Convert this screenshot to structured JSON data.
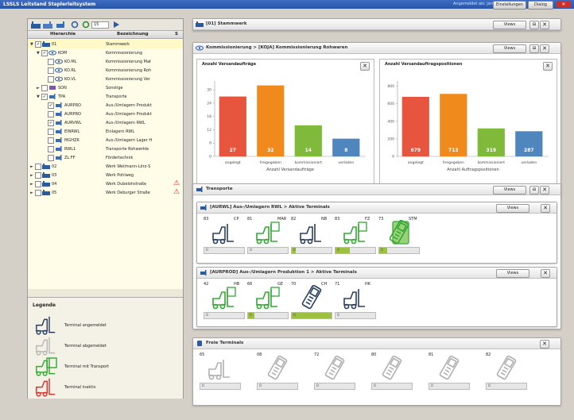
{
  "window": {
    "title": "LSSLS Leitstand Staplerleitsystem",
    "user": "Angemeldet als: jsrsdore",
    "settings_label": "Einstellungen",
    "logout_label": "Dialog",
    "close_glyph": "✕"
  },
  "tree": {
    "toolbar_value": "15",
    "headers": {
      "hierarchy": "Hierarchie",
      "name": "Bezeichnung",
      "sort": "S"
    },
    "rows": [
      {
        "label": "01",
        "desc": "Stammwerk",
        "indent": 0,
        "expander": "▼",
        "icon": "factory",
        "checked": true
      },
      {
        "label": "KOM",
        "desc": "Kommissionierung",
        "indent": 1,
        "expander": "▼",
        "icon": "eye",
        "checked": true
      },
      {
        "label": "KO.ML",
        "desc": "Kommissionierung Mat",
        "indent": 2,
        "expander": "",
        "icon": "eye",
        "checked": false
      },
      {
        "label": "KO.RL",
        "desc": "Kommissionierung Roh",
        "indent": 2,
        "expander": "",
        "icon": "eye",
        "checked": false
      },
      {
        "label": "KO.VL",
        "desc": "Kommissionierung Ver",
        "indent": 2,
        "expander": "",
        "icon": "eye",
        "checked": false
      },
      {
        "label": "SON",
        "desc": "Sonstige",
        "indent": 1,
        "expander": "►",
        "icon": "tag",
        "checked": false
      },
      {
        "label": "TPA",
        "desc": "Transporte",
        "indent": 1,
        "expander": "▼",
        "icon": "forklift",
        "checked": true
      },
      {
        "label": "AURPRO",
        "desc": "Aus-/Umlagern Produkt",
        "indent": 2,
        "expander": "",
        "icon": "forklift",
        "checked": true
      },
      {
        "label": "AURPRO",
        "desc": "Aus-/Umlagern Produkt",
        "indent": 2,
        "expander": "",
        "icon": "forklift",
        "checked": false
      },
      {
        "label": "AURVWL",
        "desc": "Aus-/Umlagern RWL",
        "indent": 2,
        "expander": "",
        "icon": "forklift",
        "checked": true
      },
      {
        "label": "EINRWL",
        "desc": "Einlagern RWL",
        "indent": 2,
        "expander": "",
        "icon": "forklift",
        "checked": false
      },
      {
        "label": "MGHZR",
        "desc": "Aus-/Umlagern Lager H",
        "indent": 2,
        "expander": "",
        "icon": "forklift",
        "checked": false
      },
      {
        "label": "RWL1",
        "desc": "Transporte Rohwerkle",
        "indent": 2,
        "expander": "",
        "icon": "forklift",
        "checked": false
      },
      {
        "label": "ZL FF",
        "desc": "Fördertechnik",
        "indent": 2,
        "expander": "",
        "icon": "forklift",
        "checked": false
      },
      {
        "label": "02",
        "desc": "Werk Weilmann-Lörz-S",
        "indent": 0,
        "expander": "►",
        "icon": "factory",
        "checked": false
      },
      {
        "label": "03",
        "desc": "Werk Pohlweg",
        "indent": 0,
        "expander": "►",
        "icon": "factory",
        "checked": false
      },
      {
        "label": "04",
        "desc": "Werk Dubelohstraße",
        "indent": 0,
        "expander": "►",
        "icon": "factory",
        "checked": false,
        "warn": true
      },
      {
        "label": "05",
        "desc": "Werk Deburger Straße",
        "indent": 0,
        "expander": "►",
        "icon": "factory",
        "checked": false,
        "warn": true
      }
    ],
    "warn_glyph": "⚠"
  },
  "legend": {
    "title": "Legende",
    "items": [
      {
        "label": "Terminal angemeldet",
        "color": "#2a3f5f"
      },
      {
        "label": "Terminal abgemeldet",
        "color": "#b8b8b8"
      },
      {
        "label": "Terminal mit Transport",
        "color": "#33a833"
      },
      {
        "label": "Terminal inaktiv",
        "color": "#d43333"
      }
    ]
  },
  "main": {
    "top_title": "[01] Stammwerk",
    "views_label": "Views",
    "kom_title": "Kommissionierung > [KOJA] Kommissionierung Rohwaren",
    "transport_title": "Transporte",
    "aurwl_title": "[AURWL] Aus-/Umlagern RWL > Aktive Terminals",
    "aurprod_title": "[AURPROD] Aus-/Umlagern Produktion 1 > Aktive Terminals",
    "free_title": "Freie Terminals",
    "x_glyph": "✕"
  },
  "charts": {
    "auftraege": {
      "title": "Anzahl Versandaufträge",
      "xlabel": "Anzahl Versandaufträge",
      "categories": [
        "angelegt",
        "freigegeben",
        "kommissioniert",
        "verladen"
      ],
      "values": [
        27,
        32,
        14,
        8
      ],
      "colors": [
        "#e8553e",
        "#f08a1d",
        "#7fba3a",
        "#4e86bd"
      ],
      "yticks": [
        0,
        6,
        12,
        18,
        24,
        30
      ],
      "ymax": 34
    },
    "positionen": {
      "title": "Anzahl Versandauftragspositionen",
      "xlabel": "Anzahl Auftragspositionen",
      "categories": [
        "angelegt",
        "freigegeben",
        "kommissioniert",
        "verladen"
      ],
      "values": [
        679,
        713,
        319,
        287
      ],
      "colors": [
        "#e8553e",
        "#f08a1d",
        "#7fba3a",
        "#4e86bd"
      ],
      "yticks": [
        0,
        200,
        400,
        600,
        800
      ],
      "ymax": 860
    }
  },
  "chart_data": [
    {
      "type": "bar",
      "title": "Anzahl Versandaufträge",
      "xlabel": "Anzahl Versandaufträge",
      "ylabel": "",
      "categories": [
        "angelegt",
        "freigegeben",
        "kommissioniert",
        "verladen"
      ],
      "values": [
        27,
        32,
        14,
        8
      ],
      "ylim": [
        0,
        34
      ]
    },
    {
      "type": "bar",
      "title": "Anzahl Versandauftragspositionen",
      "xlabel": "Anzahl Auftragspositionen",
      "ylabel": "",
      "categories": [
        "angelegt",
        "freigegeben",
        "kommissioniert",
        "verladen"
      ],
      "values": [
        679,
        713,
        319,
        287
      ],
      "ylim": [
        0,
        860
      ]
    }
  ],
  "terminals": {
    "aurwl": [
      {
        "num": "83",
        "code": "CP",
        "state": "active",
        "kind": "forklift",
        "bar_value": "0",
        "fill": 0.0
      },
      {
        "num": "81",
        "code": "MAR",
        "state": "transport",
        "kind": "forklift",
        "bar_value": "0",
        "fill": 0.0
      },
      {
        "num": "82",
        "code": "NB",
        "state": "active",
        "kind": "forklift",
        "bar_value": "0",
        "fill": 0.1
      },
      {
        "num": "83",
        "code": "FZ",
        "state": "transport",
        "kind": "forklift",
        "bar_value": "0",
        "fill": 0.35
      },
      {
        "num": "73",
        "code": "STM",
        "state": "transport",
        "kind": "handheld",
        "bar_value": "0",
        "fill": 0.2
      }
    ],
    "aurprod": [
      {
        "num": "42",
        "code": "HB",
        "state": "transport",
        "kind": "forklift",
        "bar_value": "0",
        "fill": 0.0
      },
      {
        "num": "66",
        "code": "GE",
        "state": "transport",
        "kind": "forklift",
        "bar_value": "0",
        "fill": 0.15
      },
      {
        "num": "70",
        "code": "CH",
        "state": "active",
        "kind": "handheld",
        "bar_value": "0",
        "fill": 1.0
      },
      {
        "num": "71",
        "code": "HK",
        "state": "active",
        "kind": "forklift",
        "bar_value": "0",
        "fill": 0.0
      }
    ],
    "free": [
      {
        "num": "65",
        "code": "",
        "state": "inactive",
        "kind": "forklift",
        "bar_value": "0",
        "fill": 0.0
      },
      {
        "num": "08",
        "code": "",
        "state": "inactive",
        "kind": "handheld",
        "bar_value": "0",
        "fill": 0.0
      },
      {
        "num": "72",
        "code": "",
        "state": "inactive",
        "kind": "handheld",
        "bar_value": "0",
        "fill": 0.0
      },
      {
        "num": "80",
        "code": "",
        "state": "inactive",
        "kind": "handheld",
        "bar_value": "0",
        "fill": 0.0
      },
      {
        "num": "81",
        "code": "",
        "state": "inactive",
        "kind": "handheld",
        "bar_value": "0",
        "fill": 0.0
      },
      {
        "num": "82",
        "code": "",
        "state": "inactive",
        "kind": "handheld",
        "bar_value": "0",
        "fill": 0.0
      }
    ]
  }
}
